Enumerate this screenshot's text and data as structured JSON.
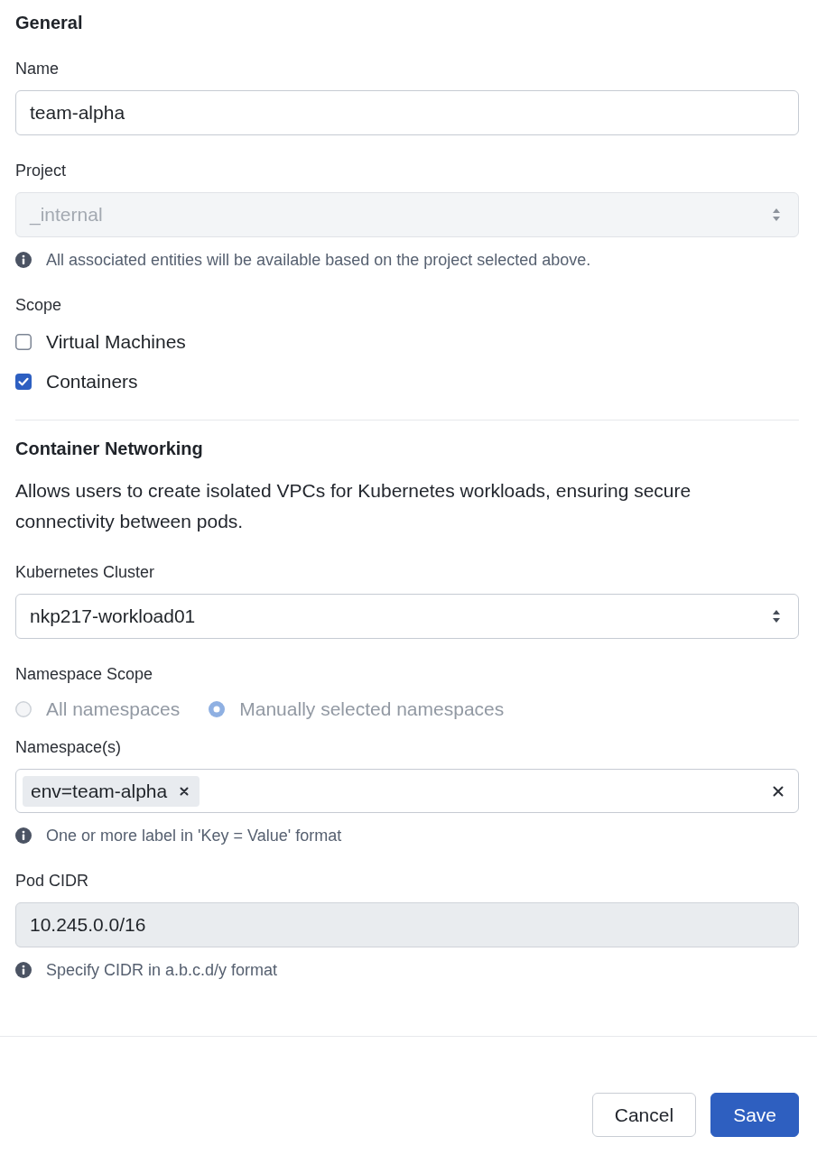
{
  "sections": [
    {
      "title": "General",
      "fields": [
        {
          "kind": "text",
          "label": "Name",
          "value": "team-alpha",
          "disabled": false
        },
        {
          "kind": "select",
          "label": "Project",
          "value": "_internal",
          "disabled": true,
          "hint": "All associated entities will be available based on the project selected above."
        },
        {
          "kind": "checkboxes",
          "label": "Scope",
          "options": [
            {
              "label": "Virtual Machines",
              "checked": false
            },
            {
              "label": "Containers",
              "checked": true
            }
          ]
        }
      ]
    },
    {
      "title": "Container Networking",
      "description": "Allows users to create isolated VPCs for Kubernetes workloads, ensuring secure connectivity between pods.",
      "fields": [
        {
          "kind": "select",
          "label": "Kubernetes Cluster",
          "value": "nkp217-workload01",
          "disabled": false
        },
        {
          "kind": "radios",
          "label": "Namespace Scope",
          "disabled": true,
          "options": [
            {
              "label": "All namespaces",
              "selected": false
            },
            {
              "label": "Manually selected namespaces",
              "selected": true
            }
          ]
        },
        {
          "kind": "tags",
          "label": "Namespace(s)",
          "tags": [
            "env=team-alpha"
          ],
          "hint": "One or more label in 'Key = Value' format"
        },
        {
          "kind": "text",
          "label": "Pod CIDR",
          "value": "10.245.0.0/16",
          "disabled": true,
          "hint": "Specify CIDR in a.b.c.d/y format"
        }
      ]
    }
  ],
  "buttons": [
    {
      "label": "Cancel",
      "kind": "secondary"
    },
    {
      "label": "Save",
      "kind": "primary"
    }
  ]
}
